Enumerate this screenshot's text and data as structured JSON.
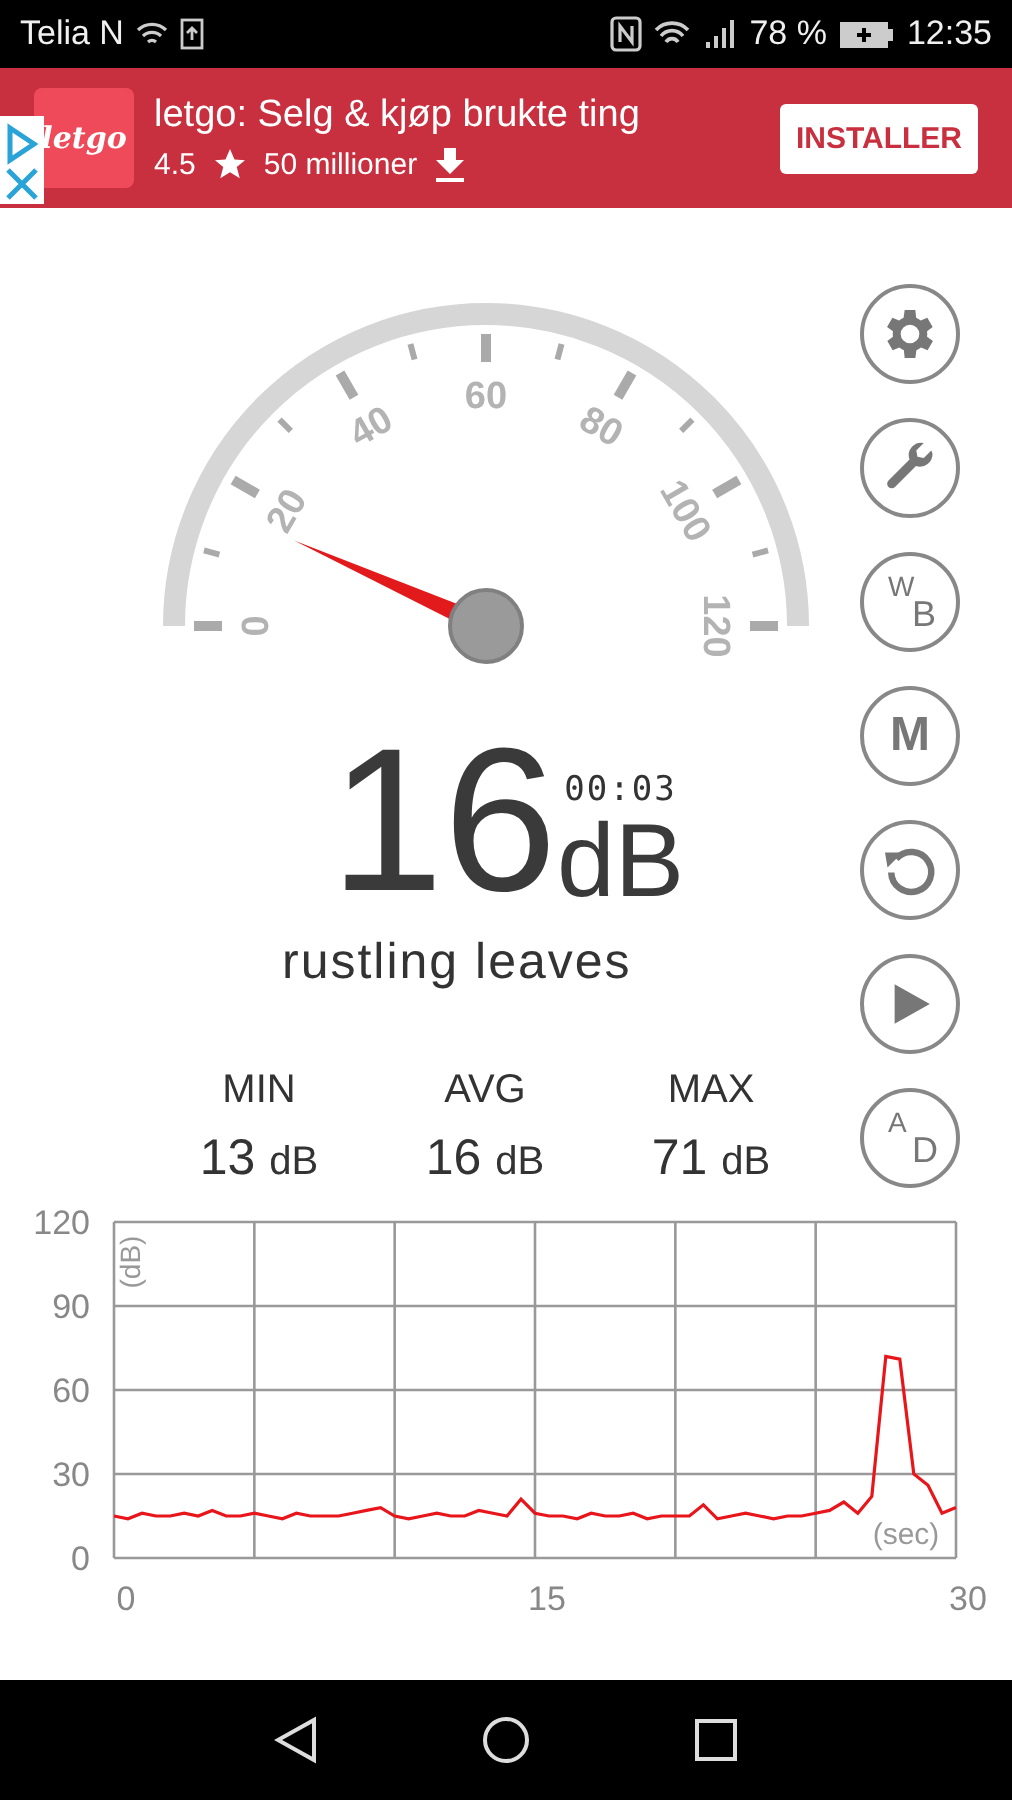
{
  "status_bar": {
    "carrier": "Telia N",
    "battery": "78 %",
    "time": "12:35"
  },
  "ad": {
    "logo": "letgo",
    "title": "letgo: Selg & kjøp brukte ting",
    "rating": "4.5",
    "downloads": "50 millioner",
    "button": "INSTALLER"
  },
  "gauge": {
    "scale_labels": [
      "0",
      "20",
      "40",
      "60",
      "80",
      "100",
      "120"
    ]
  },
  "reading": {
    "value": "16",
    "unit": "dB",
    "elapsed": "00:03",
    "description": "rustling leaves"
  },
  "stats": [
    {
      "label": "MIN",
      "value": "13",
      "unit": "dB"
    },
    {
      "label": "AVG",
      "value": "16",
      "unit": "dB"
    },
    {
      "label": "MAX",
      "value": "71",
      "unit": "dB"
    }
  ],
  "controls": [
    {
      "kind": "gear"
    },
    {
      "kind": "wrench"
    },
    {
      "kind": "letters",
      "top": "W",
      "bottom": "B"
    },
    {
      "kind": "letter",
      "text": "M"
    },
    {
      "kind": "reset"
    },
    {
      "kind": "play"
    },
    {
      "kind": "letters",
      "top": "A",
      "bottom": "D"
    }
  ],
  "chart": {
    "chart_data": {
      "type": "line",
      "grid": true,
      "ylabel": "(dB)",
      "xlabel": "(sec)",
      "xlim": [
        0,
        30
      ],
      "ylim": [
        0,
        120
      ],
      "xticks": [
        0,
        15,
        30
      ],
      "yticks": [
        0,
        30,
        60,
        90,
        120
      ],
      "x": [
        0,
        0.5,
        1,
        1.5,
        2,
        2.5,
        3,
        3.5,
        4,
        4.5,
        5,
        5.5,
        6,
        6.5,
        7,
        7.5,
        8,
        8.5,
        9,
        9.5,
        10,
        10.5,
        11,
        11.5,
        12,
        12.5,
        13,
        13.5,
        14,
        14.5,
        15,
        15.5,
        16,
        16.5,
        17,
        17.5,
        18,
        18.5,
        19,
        19.5,
        20,
        20.5,
        21,
        21.5,
        22,
        22.5,
        23,
        23.5,
        24,
        24.5,
        25,
        25.5,
        26,
        26.5,
        27,
        27.5,
        28,
        28.5,
        29,
        29.5,
        30
      ],
      "series": [
        {
          "color": "#e8161b",
          "values": [
            15,
            14,
            16,
            15,
            15,
            16,
            15,
            17,
            15,
            15,
            16,
            15,
            14,
            16,
            15,
            15,
            15,
            16,
            17,
            18,
            15,
            14,
            15,
            16,
            15,
            15,
            17,
            16,
            15,
            21,
            16,
            15,
            15,
            14,
            16,
            15,
            15,
            16,
            14,
            15,
            15,
            15,
            19,
            14,
            15,
            16,
            15,
            14,
            15,
            15,
            16,
            17,
            20,
            16,
            22,
            72,
            71,
            30,
            26,
            16,
            18
          ]
        }
      ]
    }
  }
}
